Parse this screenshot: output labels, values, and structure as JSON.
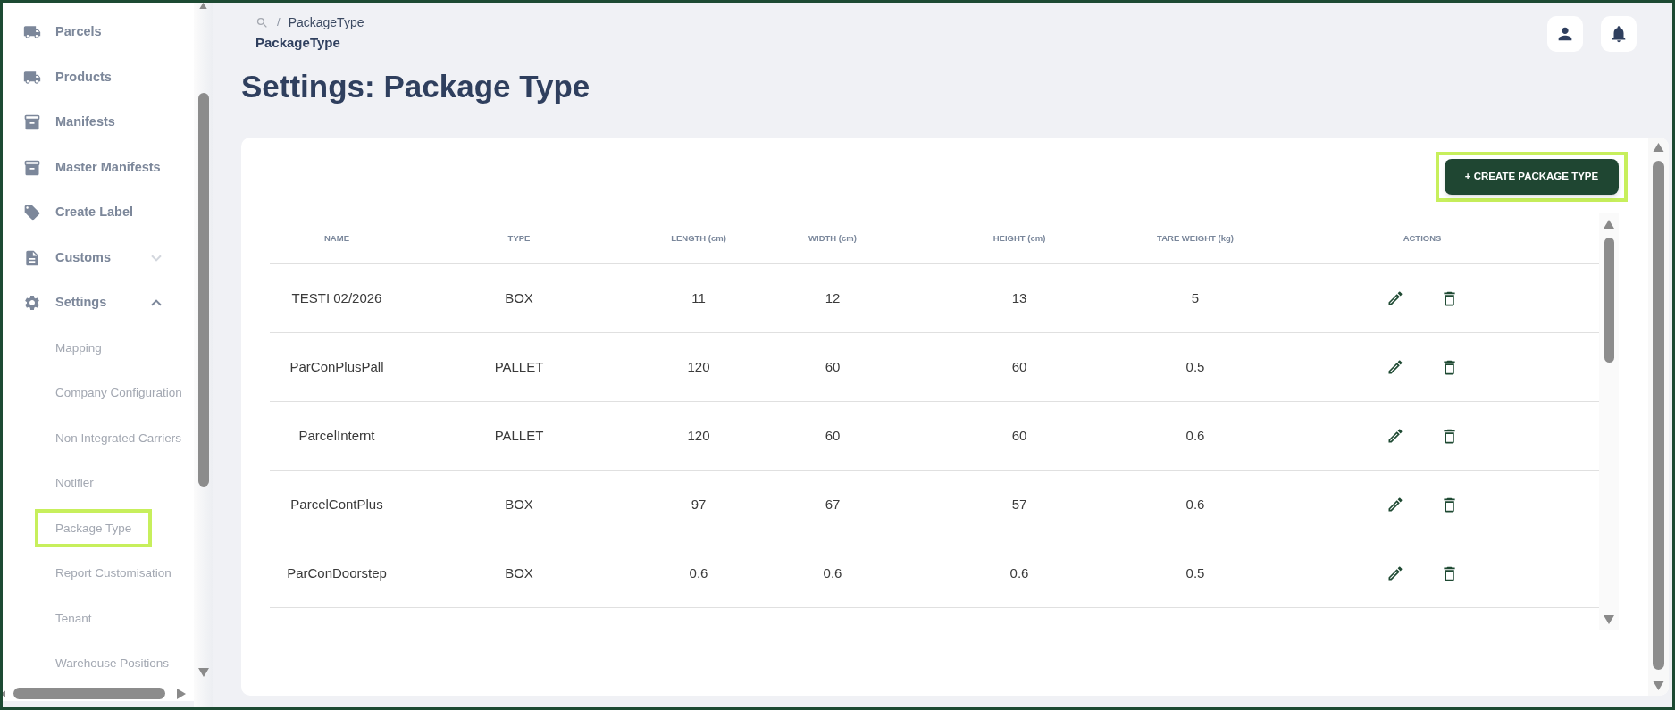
{
  "sidebar": {
    "items": [
      {
        "label": "Parcels"
      },
      {
        "label": "Products"
      },
      {
        "label": "Manifests"
      },
      {
        "label": "Master Manifests"
      },
      {
        "label": "Create Label"
      },
      {
        "label": "Customs",
        "expanded": false
      },
      {
        "label": "Settings",
        "expanded": true,
        "children": [
          {
            "label": "Mapping",
            "highlighted": false
          },
          {
            "label": "Company Configuration",
            "highlighted": false
          },
          {
            "label": "Non Integrated Carriers",
            "highlighted": false
          },
          {
            "label": "Notifier",
            "highlighted": false
          },
          {
            "label": "Package Type",
            "highlighted": true
          },
          {
            "label": "Report Customisation",
            "highlighted": false
          },
          {
            "label": "Tenant",
            "highlighted": false
          },
          {
            "label": "Warehouse Positions",
            "highlighted": false
          }
        ]
      }
    ]
  },
  "breadcrumb": {
    "separator": "/",
    "items": [
      "PackageType"
    ],
    "current": "PackageType"
  },
  "page_title": "Settings: Package Type",
  "create_button": {
    "label": "+ CREATE PACKAGE TYPE",
    "highlighted": true
  },
  "table": {
    "columns": [
      "NAME",
      "TYPE",
      "LENGTH (cm)",
      "WIDTH (cm)",
      "HEIGHT (cm)",
      "TARE WEIGHT (kg)",
      "ACTIONS"
    ],
    "rows": [
      [
        "TESTI 02/2026",
        "BOX",
        "11",
        "12",
        "13",
        "5"
      ],
      [
        "ParConPlusPall",
        "PALLET",
        "120",
        "60",
        "60",
        "0.5"
      ],
      [
        "ParcelInternt",
        "PALLET",
        "120",
        "60",
        "60",
        "0.6"
      ],
      [
        "ParcelContPlus",
        "BOX",
        "97",
        "67",
        "57",
        "0.6"
      ],
      [
        "ParConDoorstep",
        "BOX",
        "0.6",
        "0.6",
        "0.6",
        "0.5"
      ]
    ]
  }
}
